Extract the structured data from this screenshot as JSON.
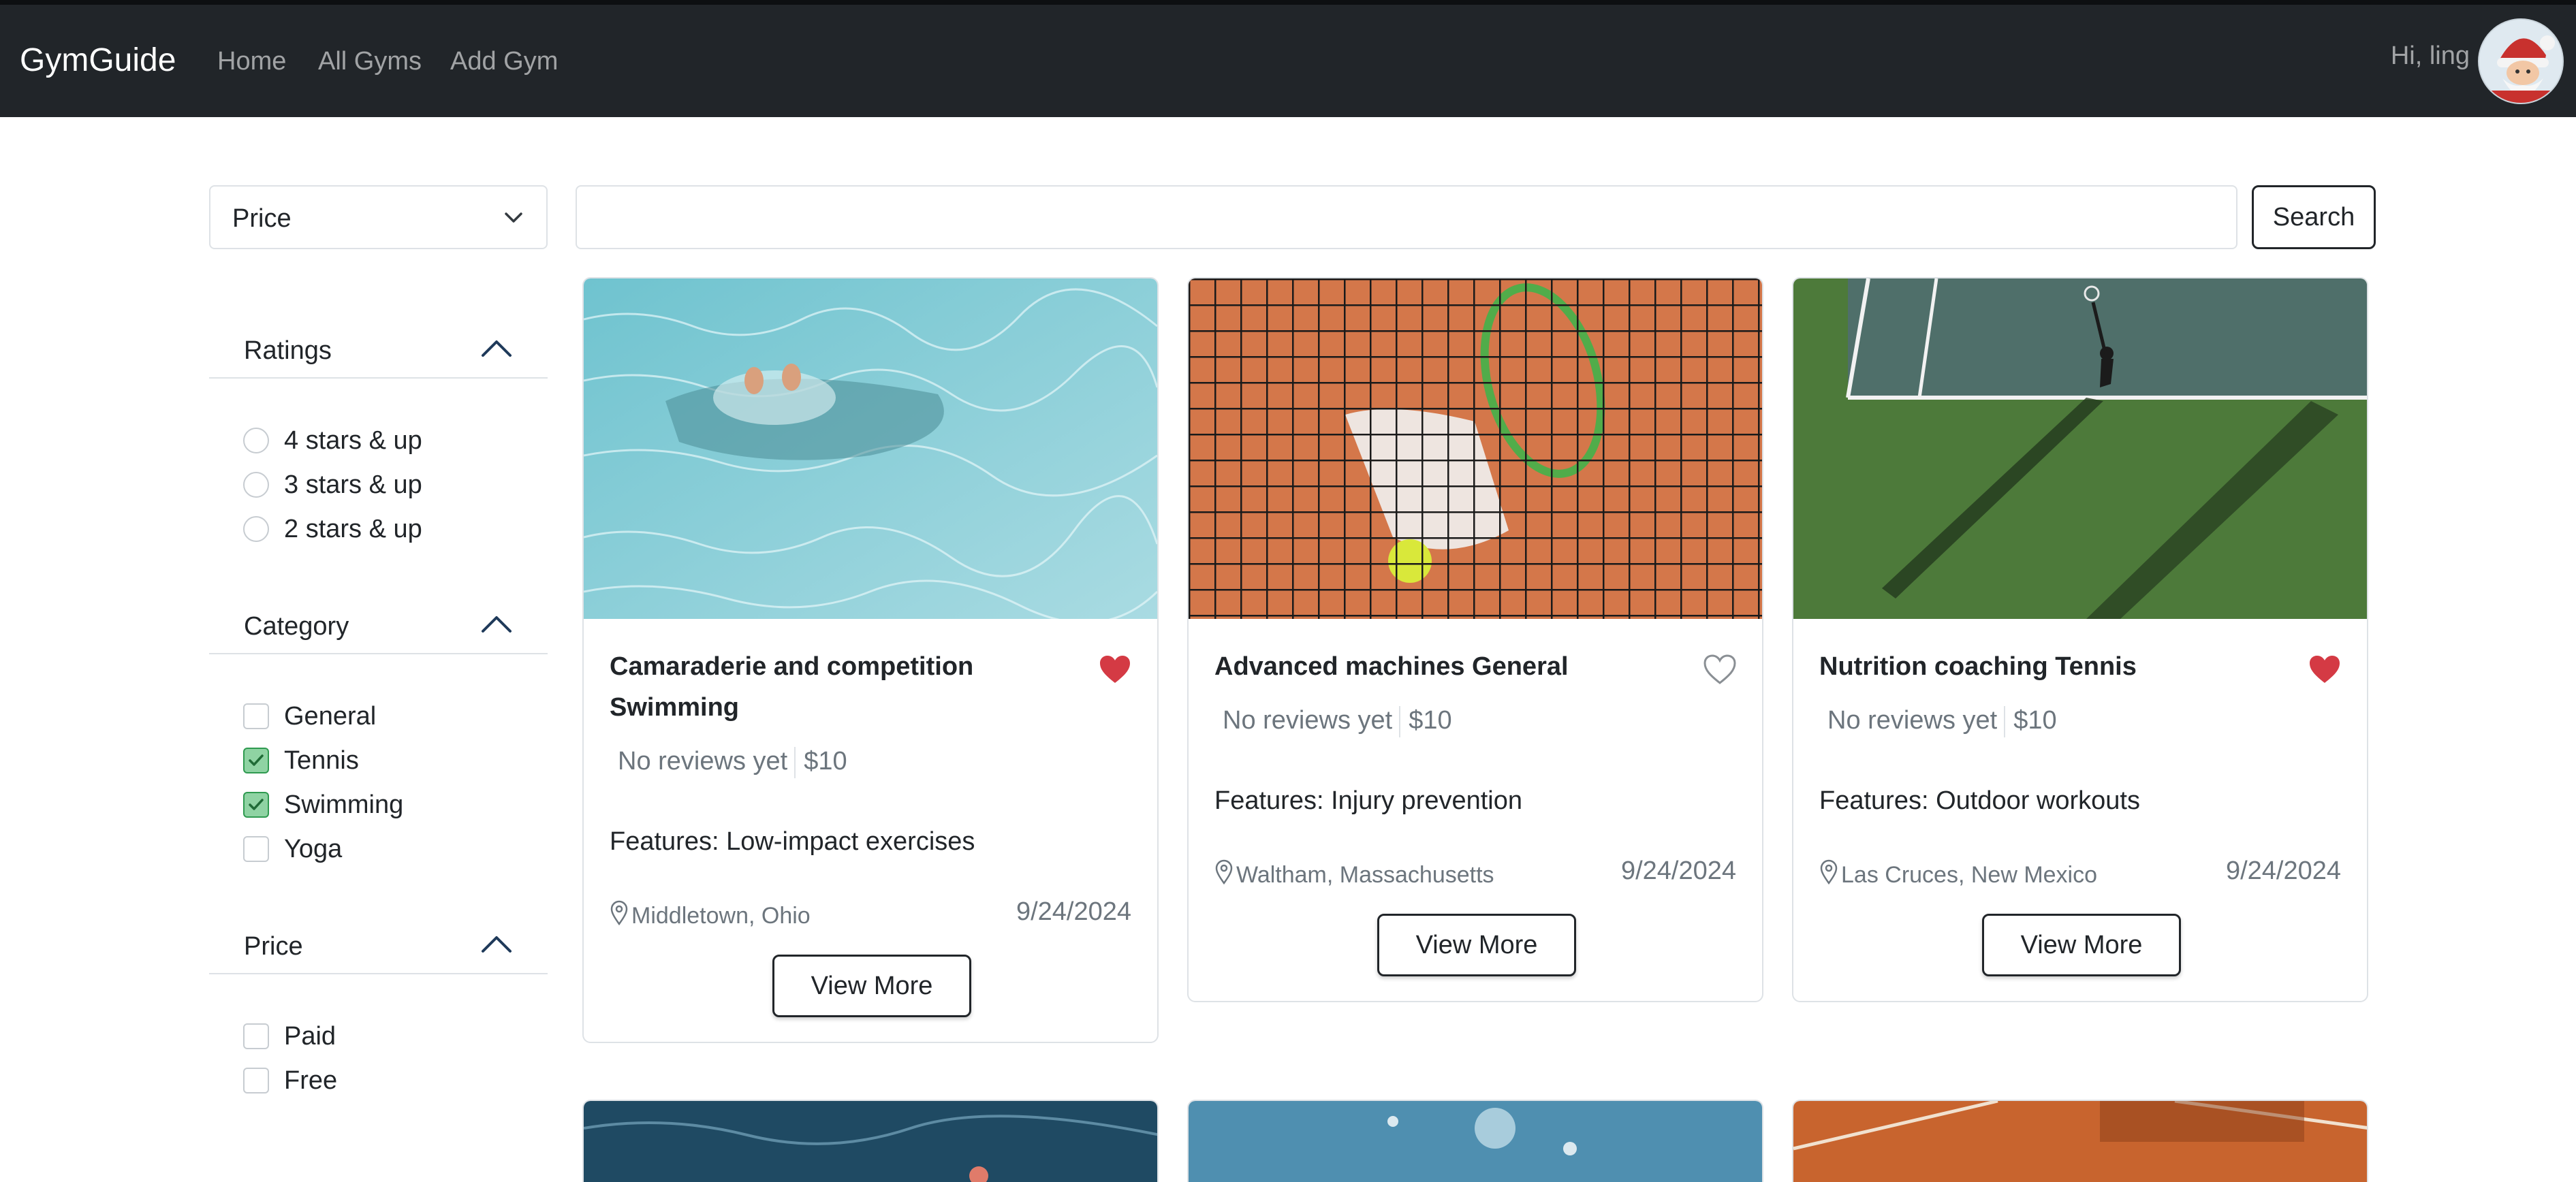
{
  "navbar": {
    "brand": "GymGuide",
    "links": [
      "Home",
      "All Gyms",
      "Add Gym"
    ],
    "greeting": "Hi, ling"
  },
  "search": {
    "sort_select": "Price",
    "query_value": "",
    "button_label": "Search"
  },
  "filters": {
    "ratings": {
      "title": "Ratings",
      "options": [
        "4 stars & up",
        "3 stars & up",
        "2 stars & up"
      ]
    },
    "category": {
      "title": "Category",
      "options": [
        "General",
        "Tennis",
        "Swimming",
        "Yoga"
      ],
      "checked": [
        false,
        true,
        true,
        false
      ]
    },
    "price": {
      "title": "Price",
      "options": [
        "Paid",
        "Free"
      ]
    }
  },
  "cards": [
    {
      "title": "Camaraderie and competition Swimming",
      "favorited": true,
      "reviews": "No reviews yet",
      "price": "$10",
      "features": "Features: Low-impact exercises",
      "location": "Middletown, Ohio",
      "date": "9/24/2024",
      "button": "View More"
    },
    {
      "title": "Advanced machines General",
      "favorited": false,
      "reviews": "No reviews yet",
      "price": "$10",
      "features": "Features: Injury prevention",
      "location": "Waltham, Massachusetts",
      "date": "9/24/2024",
      "button": "View More"
    },
    {
      "title": "Nutrition coaching Tennis",
      "favorited": true,
      "reviews": "No reviews yet",
      "price": "$10",
      "features": "Features: Outdoor workouts",
      "location": "Las Cruces, New Mexico",
      "date": "9/24/2024",
      "button": "View More"
    }
  ],
  "colors": {
    "navbar": "#212529",
    "heart_filled": "#dc3545",
    "checkbox_checked": "#8fd3a3"
  }
}
